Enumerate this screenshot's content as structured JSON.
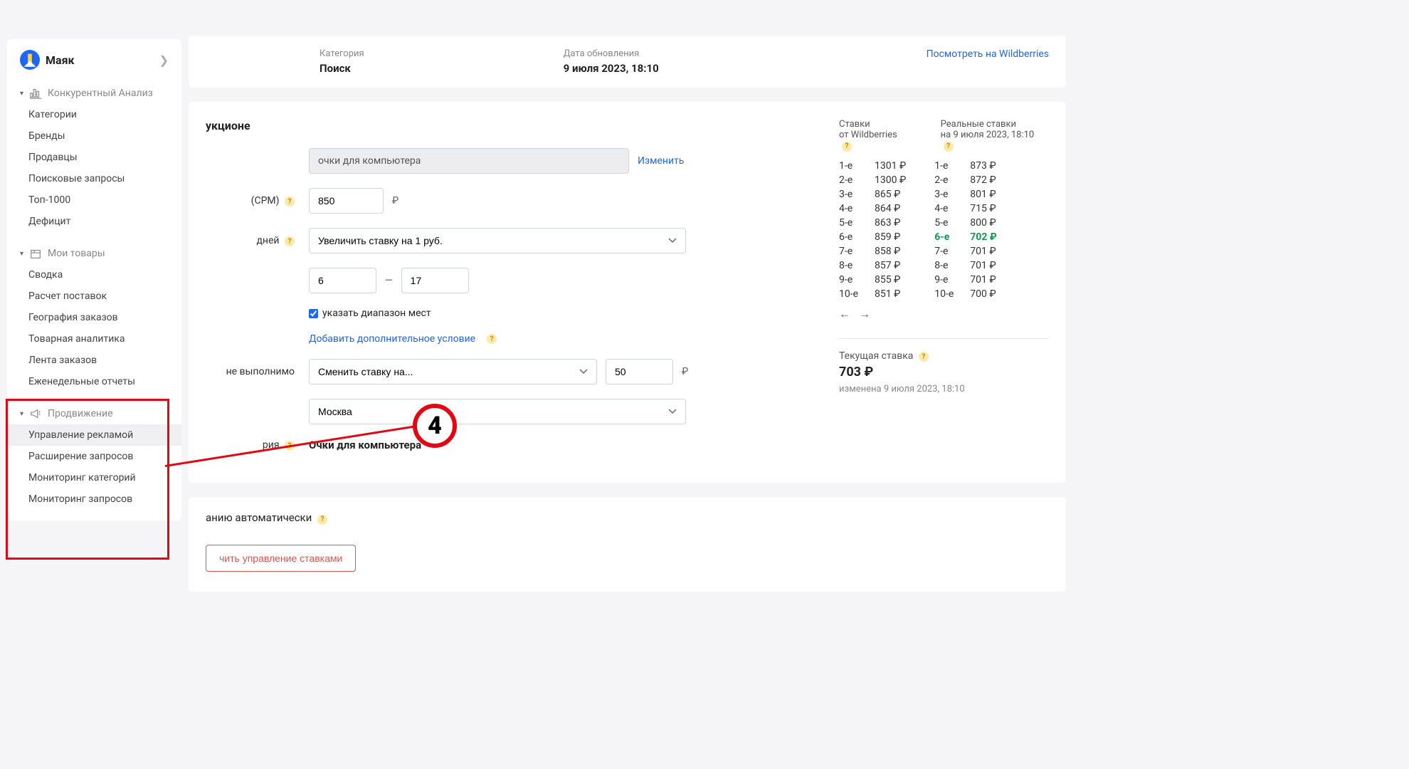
{
  "brand": "Маяк",
  "sidebar": {
    "sections": [
      {
        "title": "Конкурентный Анализ",
        "items": [
          "Категории",
          "Бренды",
          "Продавцы",
          "Поисковые запросы",
          "Топ-1000",
          "Дефицит"
        ]
      },
      {
        "title": "Мои товары",
        "items": [
          "Сводка",
          "Расчет поставок",
          "География заказов",
          "Товарная аналитика",
          "Лента заказов",
          "Еженедельные отчеты"
        ]
      },
      {
        "title": "Продвижение",
        "items": [
          "Управление рекламой",
          "Расширение запросов",
          "Мониторинг категорий",
          "Мониторинг запросов"
        ]
      }
    ]
  },
  "header": {
    "category_label": "Категория",
    "category_value": "Поиск",
    "date_label": "Дата обновления",
    "date_value": "9 июля 2023, 18:10",
    "view_link": "Посмотреть на Wildberries"
  },
  "form": {
    "title_partial": "укционе",
    "cpm_partial": "(CPM)",
    "query_value": "очки для компьютера",
    "change_link": "Изменить",
    "cpm_value": "850",
    "currency": "₽",
    "strategy_partial": "дней",
    "strategy_select": "Увеличить ставку на 1 руб.",
    "range_from": "6",
    "range_to": "17",
    "range_sep": "—",
    "checkbox_label": "указать диапазон мест",
    "add_condition": "Добавить дополнительное условие",
    "fallback_partial": "не выполнимо",
    "fallback_select": "Сменить ставку на...",
    "fallback_value": "50",
    "region_select": "Москва",
    "cat_label_partial": "рия",
    "category_value": "Очки для компьютера"
  },
  "rates": {
    "wb_label": "Ставки",
    "wb_sub": "от Wildberries",
    "real_label": "Реальные ставки",
    "real_sub": "на 9 июля 2023, 18:10",
    "wb": [
      {
        "pos": "1-е",
        "val": "1301 ₽"
      },
      {
        "pos": "2-е",
        "val": "1300 ₽"
      },
      {
        "pos": "3-е",
        "val": "865 ₽"
      },
      {
        "pos": "4-е",
        "val": "864 ₽"
      },
      {
        "pos": "5-е",
        "val": "863 ₽"
      },
      {
        "pos": "6-е",
        "val": "859 ₽"
      },
      {
        "pos": "7-е",
        "val": "858 ₽"
      },
      {
        "pos": "8-е",
        "val": "857 ₽"
      },
      {
        "pos": "9-е",
        "val": "855 ₽"
      },
      {
        "pos": "10-е",
        "val": "851 ₽"
      }
    ],
    "real": [
      {
        "pos": "1-е",
        "val": "873 ₽"
      },
      {
        "pos": "2-е",
        "val": "872 ₽"
      },
      {
        "pos": "3-е",
        "val": "801 ₽"
      },
      {
        "pos": "4-е",
        "val": "715 ₽"
      },
      {
        "pos": "5-е",
        "val": "800 ₽"
      },
      {
        "pos": "6-е",
        "val": "702 ₽",
        "hl": true
      },
      {
        "pos": "7-е",
        "val": "701 ₽"
      },
      {
        "pos": "8-е",
        "val": "701 ₽"
      },
      {
        "pos": "9-е",
        "val": "701 ₽"
      },
      {
        "pos": "10-е",
        "val": "700 ₽"
      }
    ],
    "current_label": "Текущая ставка",
    "current_value": "703 ₽",
    "current_note": "изменена 9 июля 2023, 18:10"
  },
  "auto_card": {
    "text_partial": "анию автоматически",
    "button_partial": "чить управление ставками"
  },
  "annotation": {
    "number": "4"
  }
}
